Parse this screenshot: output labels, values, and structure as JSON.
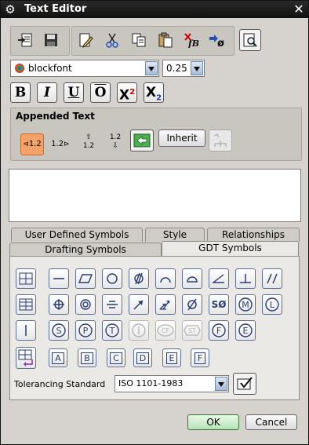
{
  "window": {
    "title": "Text Editor",
    "icon": "gear-icon",
    "close_icon": "close-x-icon"
  },
  "toolbar": {
    "buttons": [
      "import-file-icon",
      "save-icon",
      "edit-icon",
      "cut-icon",
      "copy-icon",
      "paste-icon",
      "delete-text-attributes-icon",
      "select-symbol-icon",
      "preview-icon"
    ]
  },
  "font": {
    "name": "blockfont",
    "size": "0.25"
  },
  "format": {
    "bold": "B",
    "italic": "I",
    "underline": "U",
    "overline": "O",
    "superscript": "X",
    "superscript_sup": "2",
    "subscript": "X",
    "subscript_sub": "2"
  },
  "appended": {
    "title": "Appended Text",
    "before": "1.2",
    "after": "1.2",
    "above": "1.2",
    "below": "1.2",
    "inherit_label": "Inherit"
  },
  "tabs_row1": [
    "User Defined Symbols",
    "Style",
    "Relationships"
  ],
  "tabs_row2": [
    "Drafting Symbols",
    "GDT Symbols"
  ],
  "active_tab": "GDT Symbols",
  "gdt": {
    "datum_letters": [
      "A",
      "B",
      "C",
      "D",
      "E",
      "F"
    ],
    "free_state": "CF",
    "statistical": "ST",
    "standard_label": "Tolerancing Standard",
    "standard_value": "ISO 1101-1983"
  },
  "footer": {
    "ok": "OK",
    "cancel": "Cancel"
  }
}
